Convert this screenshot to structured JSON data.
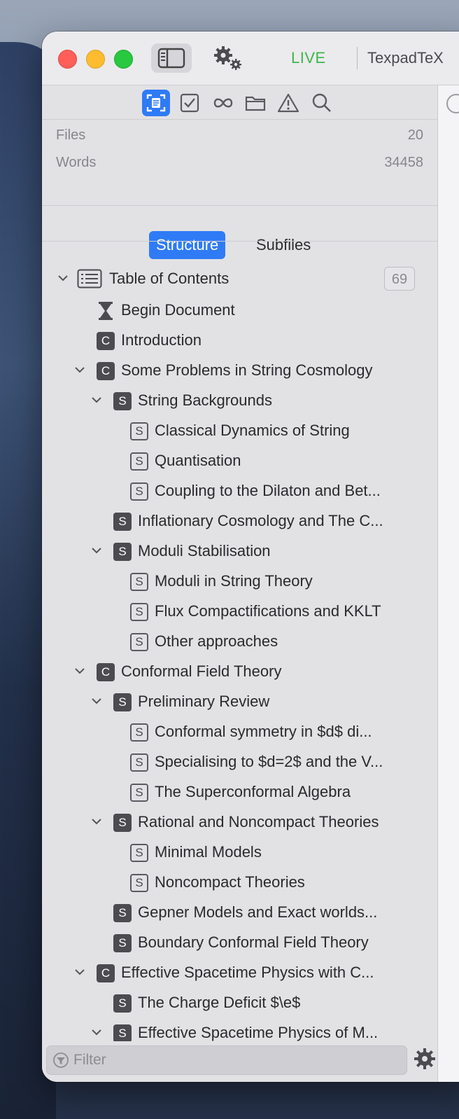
{
  "titlebar": {
    "live_label": "LIVE",
    "document_title": "TexpadTeX"
  },
  "stats": {
    "files_label": "Files",
    "files_value": "20",
    "words_label": "Words",
    "words_value": "34458"
  },
  "tabs": {
    "structure": "Structure",
    "subfiles": "Subfiles"
  },
  "toc": {
    "label": "Table of Contents",
    "count": "69"
  },
  "tree": [
    {
      "label": "Begin Document"
    },
    {
      "label": "Introduction"
    },
    {
      "label": "Some Problems in String Cosmology"
    },
    {
      "label": "String Backgrounds"
    },
    {
      "label": "Classical Dynamics of String"
    },
    {
      "label": "Quantisation"
    },
    {
      "label": "Coupling to the Dilaton and Bet..."
    },
    {
      "label": "Inflationary Cosmology and The C..."
    },
    {
      "label": "Moduli Stabilisation"
    },
    {
      "label": "Moduli in String Theory"
    },
    {
      "label": "Flux Compactifications and KKLT"
    },
    {
      "label": "Other approaches"
    },
    {
      "label": "Conformal Field Theory"
    },
    {
      "label": "Preliminary Review"
    },
    {
      "label": "Conformal symmetry in $d$ di..."
    },
    {
      "label": "Specialising to $d=2$ and the V..."
    },
    {
      "label": "The Superconformal Algebra"
    },
    {
      "label": "Rational and Noncompact Theories"
    },
    {
      "label": "Minimal Models"
    },
    {
      "label": "Noncompact Theories"
    },
    {
      "label": "Gepner Models and Exact worlds..."
    },
    {
      "label": "Boundary Conformal Field Theory"
    },
    {
      "label": "Effective Spacetime Physics with C..."
    },
    {
      "label": "The Charge Deficit $\\e$"
    },
    {
      "label": "Effective Spacetime Physics of M..."
    }
  ],
  "badges": {
    "chapter": "C",
    "section": "S"
  },
  "filter": {
    "placeholder": "Filter"
  },
  "colors": {
    "accent": "#2f7bf6",
    "live": "#3fb54a"
  }
}
